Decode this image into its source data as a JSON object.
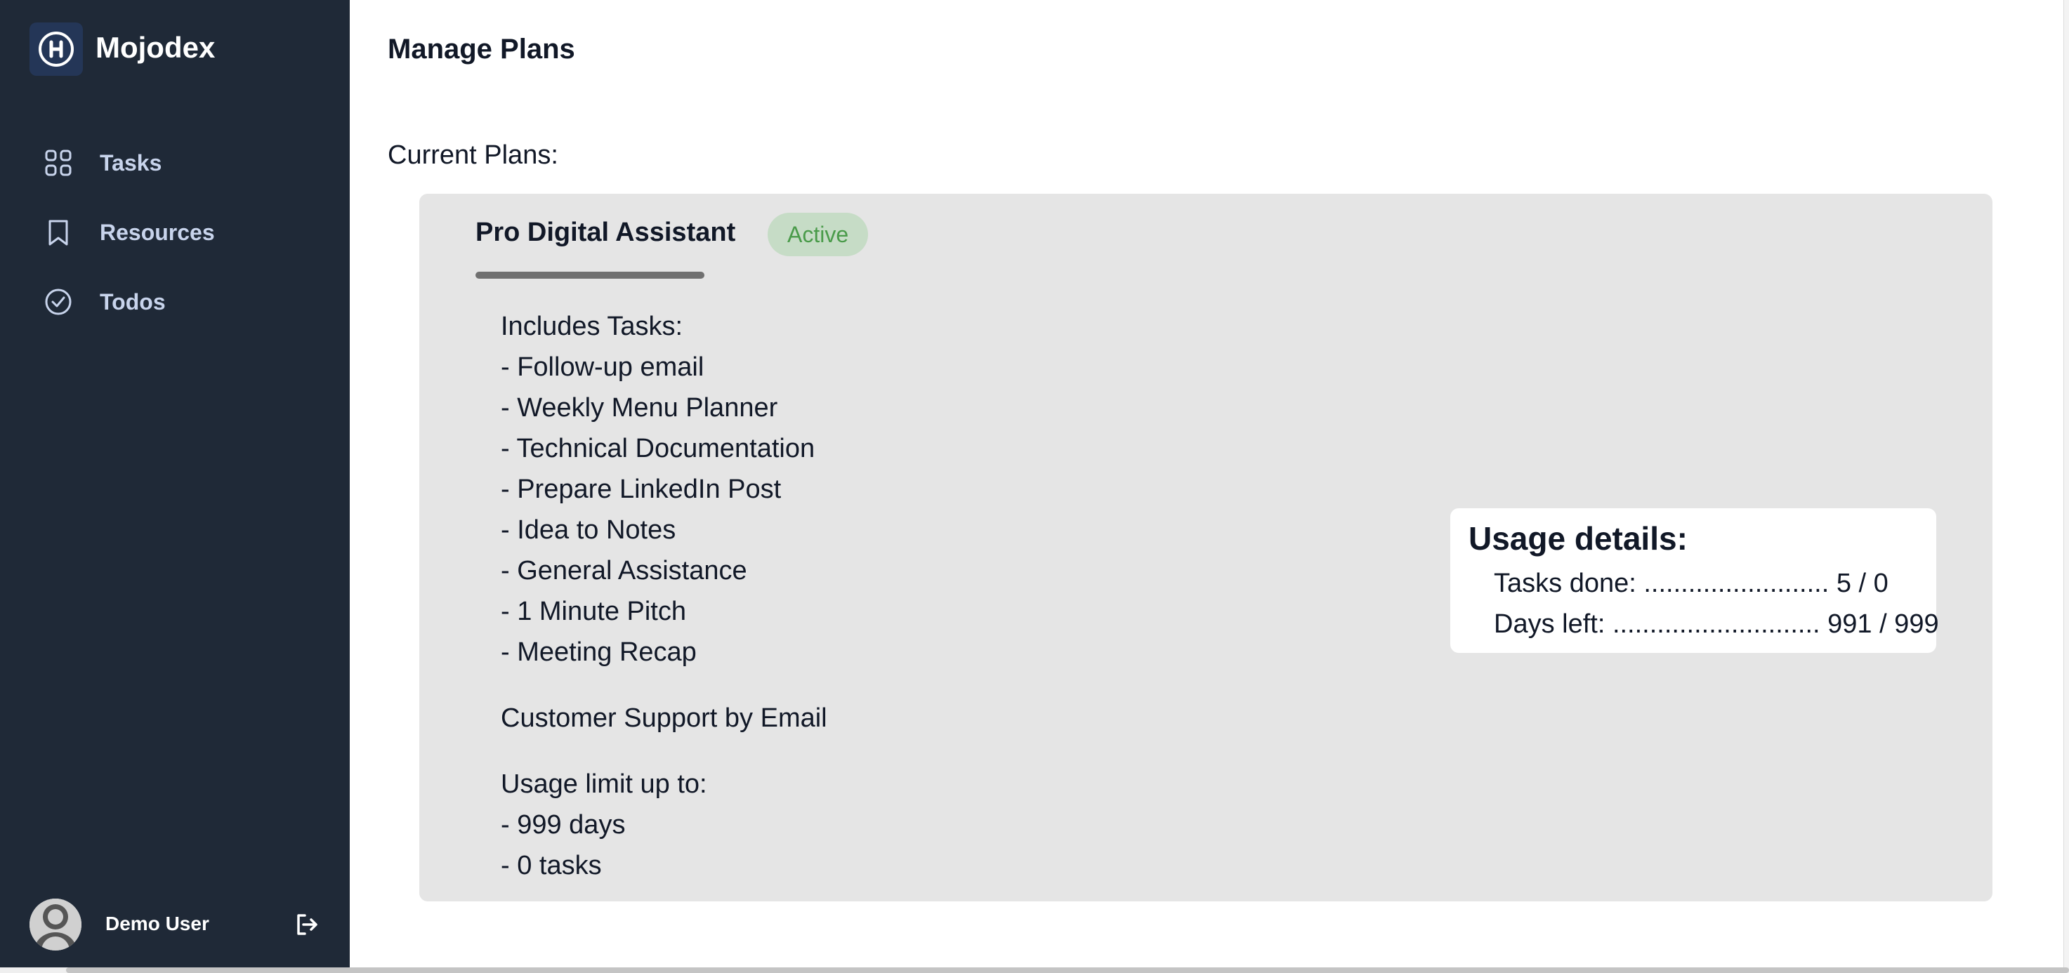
{
  "app": {
    "name": "Mojodex",
    "logo_letter": "H"
  },
  "sidebar": {
    "items": [
      {
        "label": "Tasks",
        "icon": "grid-icon"
      },
      {
        "label": "Resources",
        "icon": "bookmark-icon"
      },
      {
        "label": "Todos",
        "icon": "check-circle-icon"
      }
    ],
    "user": {
      "name": "Demo User",
      "avatar_icon": "avatar-icon",
      "logout_icon": "logout-icon"
    }
  },
  "main": {
    "title": "Manage Plans",
    "current_plans_label": "Current Plans:",
    "plan": {
      "name": "Pro Digital Assistant",
      "status": "Active",
      "includes_label": "Includes Tasks:",
      "tasks": [
        "- Follow-up email",
        "- Weekly Menu Planner",
        "- Technical Documentation",
        "- Prepare LinkedIn Post",
        "- Idea to Notes",
        "- General Assistance",
        "- 1 Minute Pitch",
        "- Meeting Recap"
      ],
      "support": "Customer Support by Email",
      "usage_limit_label": "Usage limit up to:",
      "usage_limits": [
        "- 999 days",
        "- 0 tasks"
      ]
    },
    "usage_details": {
      "title": "Usage details:",
      "tasks_done": "Tasks done: ......................... 5 / 0",
      "days_left": "Days left: ............................ 991 / 999"
    }
  },
  "colors": {
    "sidebar_bg": "#1f2937",
    "card_bg": "#e5e5e5",
    "active_badge_bg": "#c6dcc6",
    "active_badge_text": "#4a9b4a"
  }
}
